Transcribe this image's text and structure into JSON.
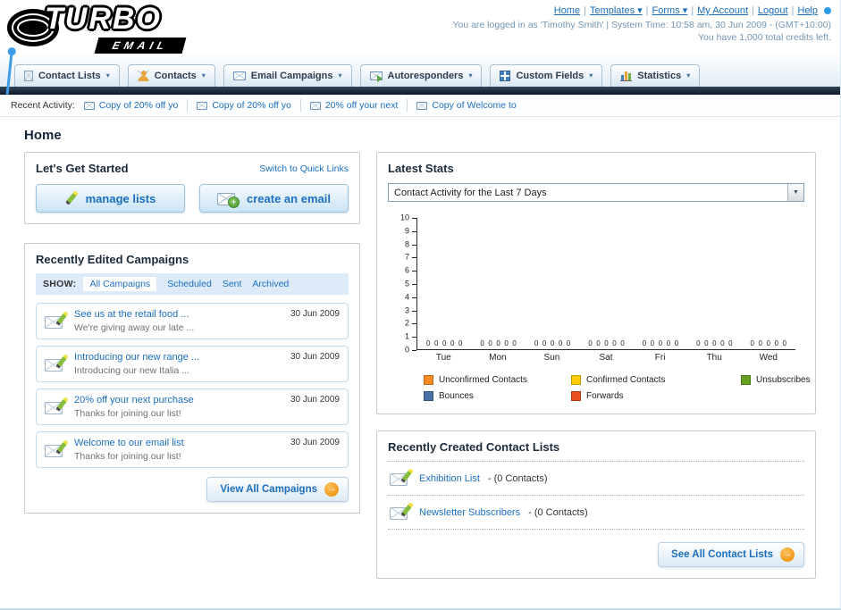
{
  "page_title": "Home",
  "header": {
    "logo": {
      "title": "TURBO",
      "subtitle": "EMAIL"
    },
    "nav": [
      {
        "label": "Home",
        "dropdown": false
      },
      {
        "label": "Templates",
        "dropdown": true
      },
      {
        "label": "Forms",
        "dropdown": true
      },
      {
        "label": "My Account",
        "dropdown": false
      },
      {
        "label": "Logout",
        "dropdown": false
      },
      {
        "label": "Help",
        "dropdown": false
      }
    ],
    "login_info": "You are logged in as 'Timothy Smith' | System Time: 10:58 am, 30 Jun 2009 - (GMT+10:00)",
    "credits_info": "You have 1,000 total credits left."
  },
  "main_nav": {
    "tabs": [
      {
        "label": "Contact Lists",
        "icon": "contact-lists-icon"
      },
      {
        "label": "Contacts",
        "icon": "contacts-icon"
      },
      {
        "label": "Email Campaigns",
        "icon": "email-campaigns-icon"
      },
      {
        "label": "Autoresponders",
        "icon": "autoresponders-icon"
      },
      {
        "label": "Custom Fields",
        "icon": "custom-fields-icon"
      },
      {
        "label": "Statistics",
        "icon": "statistics-icon"
      }
    ]
  },
  "recent_activity": {
    "label": "Recent Activity:",
    "items": [
      "Copy of 20% off yo",
      "Copy of 20% off yo",
      "20% off your next",
      "Copy of Welcome to"
    ]
  },
  "get_started": {
    "title": "Let's Get Started",
    "switch_link": "Switch to Quick Links",
    "manage_lists_label": "manage lists",
    "create_email_label": "create an email"
  },
  "campaigns": {
    "title": "Recently Edited Campaigns",
    "show_label": "SHOW:",
    "filters": [
      {
        "label": "All Campaigns",
        "selected": true
      },
      {
        "label": "Scheduled",
        "selected": false
      },
      {
        "label": "Sent",
        "selected": false
      },
      {
        "label": "Archived",
        "selected": false
      }
    ],
    "items": [
      {
        "title": "See us at the retail food ...",
        "subtitle": "We're giving away our late ...",
        "date": "30 Jun 2009"
      },
      {
        "title": "Introducing our new range ...",
        "subtitle": "Introducing our new Italia ...",
        "date": "30 Jun 2009"
      },
      {
        "title": "20% off your next purchase",
        "subtitle": "Thanks for joining our list!",
        "date": "30 Jun 2009"
      },
      {
        "title": "Welcome to our email list",
        "subtitle": "Thanks for joining our list!",
        "date": "30 Jun 2009"
      }
    ],
    "view_all_label": "View All Campaigns"
  },
  "stats": {
    "title": "Latest Stats",
    "dropdown_value": "Contact Activity for the Last 7 Days",
    "chart_data": {
      "type": "bar",
      "title": "Contact Activity for the Last 7 Days",
      "categories": [
        "Tue",
        "Mon",
        "Sun",
        "Sat",
        "Fri",
        "Thu",
        "Wed"
      ],
      "series": [
        {
          "name": "Unconfirmed Contacts",
          "color": "#F6891F",
          "values": [
            0,
            0,
            0,
            0,
            0,
            0,
            0
          ]
        },
        {
          "name": "Confirmed Contacts",
          "color": "#FFCC00",
          "values": [
            0,
            0,
            0,
            0,
            0,
            0,
            0
          ]
        },
        {
          "name": "Unsubscribes",
          "color": "#64A01E",
          "values": [
            0,
            0,
            0,
            0,
            0,
            0,
            0
          ]
        },
        {
          "name": "Bounces",
          "color": "#4A6FA5",
          "values": [
            0,
            0,
            0,
            0,
            0,
            0,
            0
          ]
        },
        {
          "name": "Forwards",
          "color": "#E84E1F",
          "values": [
            0,
            0,
            0,
            0,
            0,
            0,
            0
          ]
        }
      ],
      "ylim": [
        0,
        10
      ],
      "y_ticks": [
        0,
        1,
        2,
        3,
        4,
        5,
        6,
        7,
        8,
        9,
        10
      ],
      "grid": false,
      "legend_position": "bottom",
      "data_labels": true
    }
  },
  "contact_lists": {
    "title": "Recently Created Contact Lists",
    "items": [
      {
        "name": "Exhibition List",
        "detail": " - (0 Contacts)"
      },
      {
        "name": "Newsletter Subscribers",
        "detail": " - (0 Contacts)"
      }
    ],
    "see_all_label": "See All Contact Lists"
  }
}
